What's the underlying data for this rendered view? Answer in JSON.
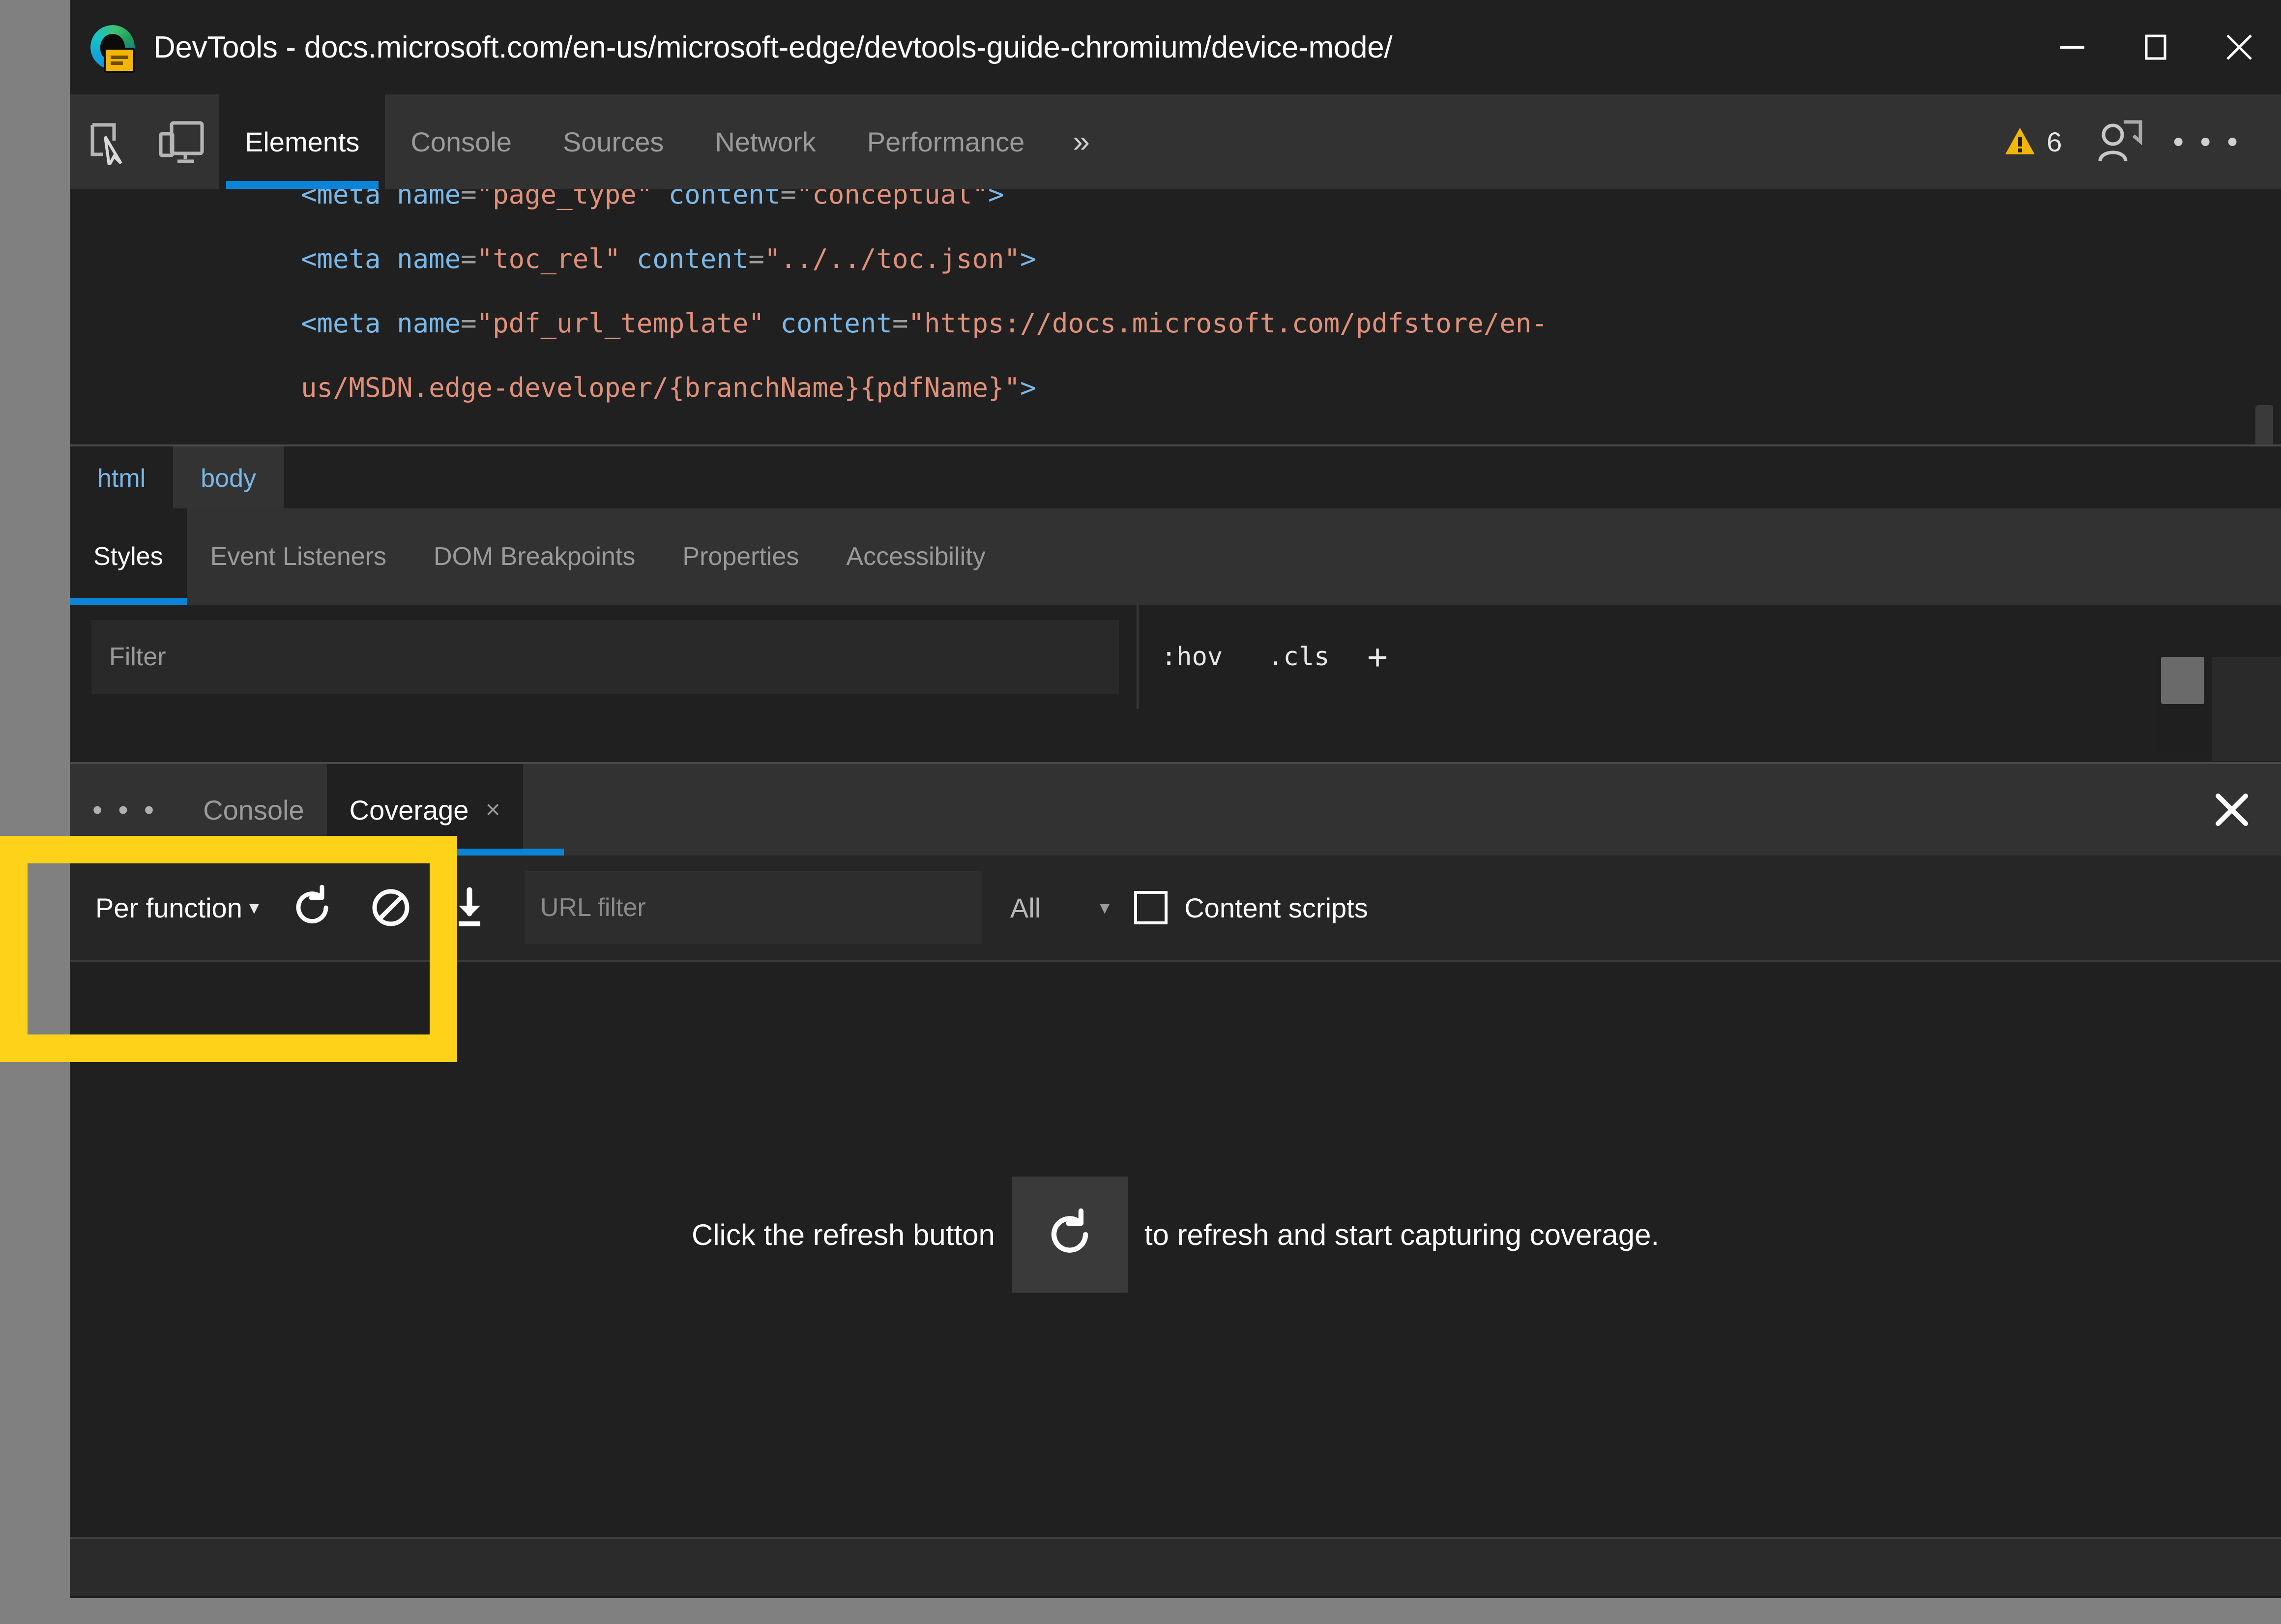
{
  "window": {
    "title": "DevTools - docs.microsoft.com/en-us/microsoft-edge/devtools-guide-chromium/device-mode/",
    "controls": {
      "minimize": "minimize-button",
      "maximize": "maximize-button",
      "close": "close-button"
    },
    "logo_name": "microsoft-edge-devtools-logo"
  },
  "panel_tabs": {
    "inspect_icon": "inspect-element-icon",
    "device_icon": "device-emulation-icon",
    "items": [
      {
        "label": "Elements",
        "active": true
      },
      {
        "label": "Console",
        "active": false
      },
      {
        "label": "Sources",
        "active": false
      },
      {
        "label": "Network",
        "active": false
      },
      {
        "label": "Performance",
        "active": false
      }
    ],
    "more_tabs": "»",
    "warning_count": "6",
    "warning_icon": "warning-triangle-icon",
    "feedback_icon": "feedback-person-icon",
    "more_options": "• • •"
  },
  "dom": {
    "lines": [
      {
        "clipped": true,
        "parts": [
          {
            "t": "<meta ",
            "c": "tagc"
          },
          {
            "t": "name",
            "c": "attrc"
          },
          {
            "t": "=",
            "c": "eqc"
          },
          {
            "t": "\"page_type\"",
            "c": "valc"
          },
          {
            "t": " content",
            "c": "attrc"
          },
          {
            "t": "=",
            "c": "eqc"
          },
          {
            "t": "\"conceptual\"",
            "c": "valc"
          },
          {
            "t": ">",
            "c": "punc"
          }
        ]
      },
      {
        "clipped": false,
        "parts": [
          {
            "t": "<meta ",
            "c": "tagc"
          },
          {
            "t": "name",
            "c": "attrc"
          },
          {
            "t": "=",
            "c": "eqc"
          },
          {
            "t": "\"toc_rel\"",
            "c": "valc"
          },
          {
            "t": " content",
            "c": "attrc"
          },
          {
            "t": "=",
            "c": "eqc"
          },
          {
            "t": "\"../../toc.json\"",
            "c": "valc"
          },
          {
            "t": ">",
            "c": "punc"
          }
        ]
      },
      {
        "clipped": false,
        "parts": [
          {
            "t": "<meta ",
            "c": "tagc"
          },
          {
            "t": "name",
            "c": "attrc"
          },
          {
            "t": "=",
            "c": "eqc"
          },
          {
            "t": "\"pdf_url_template\"",
            "c": "valc"
          },
          {
            "t": " content",
            "c": "attrc"
          },
          {
            "t": "=",
            "c": "eqc"
          },
          {
            "t": "\"https://docs.microsoft.com/pdfstore/en-",
            "c": "valc"
          }
        ]
      },
      {
        "clipped": false,
        "parts": [
          {
            "t": "us/MSDN.edge-developer/{branchName}{pdfName}\"",
            "c": "valc"
          },
          {
            "t": ">",
            "c": "punc"
          }
        ]
      }
    ]
  },
  "breadcrumb": {
    "items": [
      {
        "label": "html",
        "selected": false
      },
      {
        "label": "body",
        "selected": true
      }
    ]
  },
  "styles_tabs": {
    "items": [
      {
        "label": "Styles",
        "active": true
      },
      {
        "label": "Event Listeners",
        "active": false
      },
      {
        "label": "DOM Breakpoints",
        "active": false
      },
      {
        "label": "Properties",
        "active": false
      },
      {
        "label": "Accessibility",
        "active": false
      }
    ]
  },
  "styles_toolbar": {
    "filter_placeholder": "Filter",
    "filter_value": "",
    "hov_label": ":hov",
    "cls_label": ".cls",
    "new_rule_label": "+"
  },
  "drawer": {
    "more_dots": "• • •",
    "tabs": [
      {
        "label": "Console",
        "active": false,
        "closable": false
      },
      {
        "label": "Coverage",
        "active": true,
        "closable": true,
        "close_glyph": "×"
      }
    ],
    "close_drawer": "close-drawer-icon"
  },
  "coverage_toolbar": {
    "granularity_label": "Per function",
    "granularity_caret": "▾",
    "reload_icon": "reload-and-start-coverage-icon",
    "clear_icon": "clear-coverage-icon",
    "export_icon": "export-coverage-icon",
    "url_filter_placeholder": "URL filter",
    "url_filter_value": "",
    "type_filter_label": "All",
    "type_filter_caret": "▾",
    "content_scripts_label": "Content scripts",
    "content_scripts_checked": false
  },
  "coverage_body": {
    "empty_text_before": "Click the refresh button",
    "empty_icon": "refresh-icon",
    "empty_text_after": "to refresh and start capturing coverage."
  },
  "annotation": {
    "name": "per-function-highlight",
    "color": "#FFD21A"
  }
}
